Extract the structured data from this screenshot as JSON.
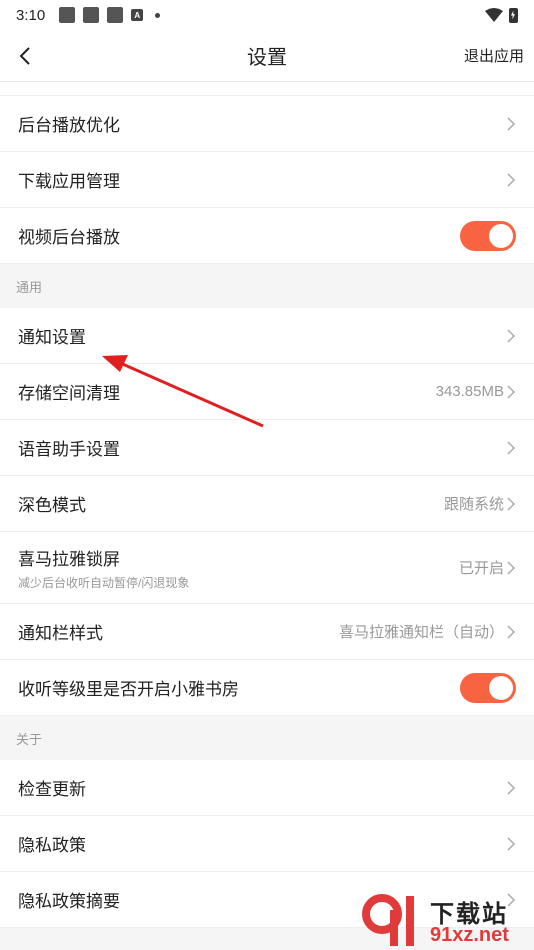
{
  "status_bar": {
    "time": "3:10",
    "notif_a": "A"
  },
  "header": {
    "title": "设置",
    "exit_label": "退出应用"
  },
  "group1": [
    {
      "label": "后台播放优化",
      "type": "chevron"
    },
    {
      "label": "下载应用管理",
      "type": "chevron"
    },
    {
      "label": "视频后台播放",
      "type": "toggle",
      "on": true
    }
  ],
  "section_general": "通用",
  "general": [
    {
      "label": "通知设置",
      "type": "chevron"
    },
    {
      "label": "存储空间清理",
      "value": "343.85MB",
      "type": "chevron"
    },
    {
      "label": "语音助手设置",
      "type": "chevron"
    },
    {
      "label": "深色模式",
      "value": "跟随系统",
      "type": "chevron"
    },
    {
      "label": "喜马拉雅锁屏",
      "sub": "减少后台收听自动暂停/闪退现象",
      "value": "已开启",
      "type": "chevron"
    },
    {
      "label": "通知栏样式",
      "value": "喜马拉雅通知栏（自动）",
      "type": "chevron"
    },
    {
      "label": "收听等级里是否开启小雅书房",
      "type": "toggle",
      "on": true
    }
  ],
  "section_about": "关于",
  "about": [
    {
      "label": "检查更新",
      "type": "chevron"
    },
    {
      "label": "隐私政策",
      "type": "chevron"
    },
    {
      "label": "隐私政策摘要",
      "type": "chevron"
    }
  ],
  "watermark": {
    "line1": "下载站",
    "line2": "91xz.net"
  },
  "colors": {
    "accent": "#f86442",
    "annotation": "#e02020"
  }
}
